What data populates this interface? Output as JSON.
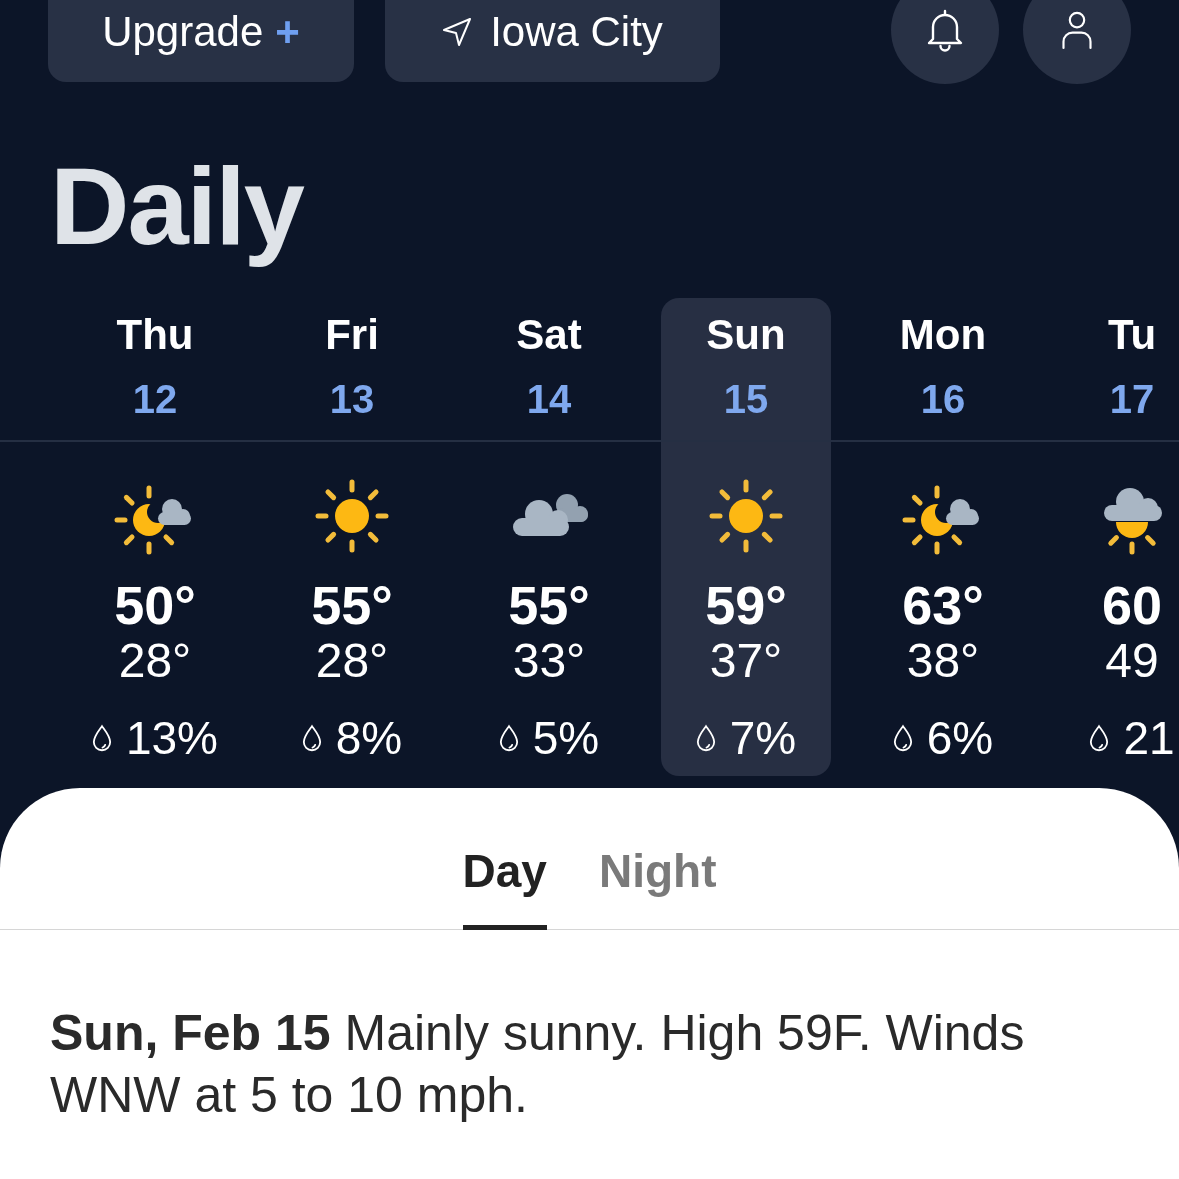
{
  "top_bar": {
    "upgrade_button": {
      "label": "Upgrade",
      "symbol": "+"
    },
    "location_button": {
      "label": "Iowa City"
    }
  },
  "title": "Daily",
  "days": [
    {
      "name": "Thu",
      "date": "12",
      "kind": "partly-cloudy",
      "high": "50°",
      "low": "28°",
      "precip": "13%",
      "selected": false
    },
    {
      "name": "Fri",
      "date": "13",
      "kind": "sunny",
      "high": "55°",
      "low": "28°",
      "precip": "8%",
      "selected": false
    },
    {
      "name": "Sat",
      "date": "14",
      "kind": "cloudy",
      "high": "55°",
      "low": "33°",
      "precip": "5%",
      "selected": false
    },
    {
      "name": "Sun",
      "date": "15",
      "kind": "sunny",
      "high": "59°",
      "low": "37°",
      "precip": "7%",
      "selected": true
    },
    {
      "name": "Mon",
      "date": "16",
      "kind": "partly-cloudy",
      "high": "63°",
      "low": "38°",
      "precip": "6%",
      "selected": false
    },
    {
      "name": "Tu",
      "date": "17",
      "kind": "mostly-cloudy",
      "high": "60",
      "low": "49",
      "precip": "21",
      "selected": false
    }
  ],
  "detail": {
    "tabs": [
      {
        "label": "Day",
        "selected": true
      },
      {
        "label": "Night",
        "selected": false
      }
    ],
    "summary": "**Sun, Feb 15** Mainly sunny. High 59F. Winds WNW at 5 to 10 mph."
  }
}
